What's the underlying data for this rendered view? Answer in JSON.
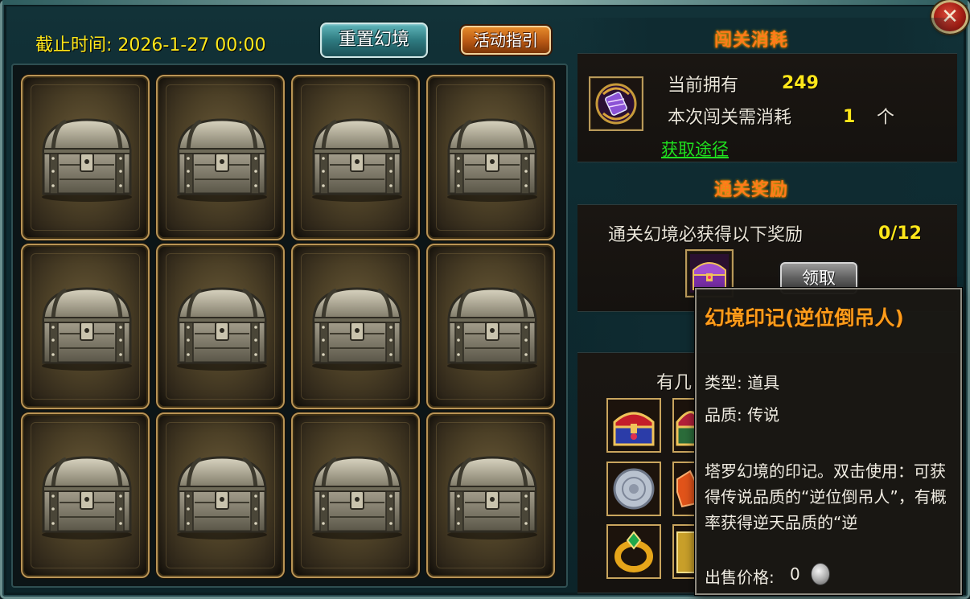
{
  "header": {
    "deadline": "截止时间: 2026-1-27 00:00",
    "reset_button": "重置幻境",
    "guide_button": "活动指引",
    "close_glyph": "✕"
  },
  "grid": {
    "chests": [
      "chest",
      "chest",
      "chest",
      "chest",
      "chest",
      "chest",
      "chest",
      "chest",
      "chest",
      "chest",
      "chest",
      "chest"
    ]
  },
  "cost": {
    "title": "闯关消耗",
    "owned_label": "当前拥有",
    "owned_value": "249",
    "need_label": "本次闯关需消耗",
    "need_value": "1",
    "need_unit": "个",
    "acquire_link": "获取途径"
  },
  "reward": {
    "title": "通关奖励",
    "desc": "通关幻境必获得以下奖励",
    "progress": "0/12",
    "claim_button": "领取"
  },
  "pool": {
    "label_partial": "有几"
  },
  "tooltip": {
    "title": "幻境印记(逆位倒吊人)",
    "type": "类型: 道具",
    "quality": "品质: 传说",
    "description": "塔罗幻境的印记。双击使用：可获得传说品质的“逆位倒吊人”，有概率获得逆天品质的“逆",
    "price_label": "出售价格:",
    "price_value": "0"
  },
  "colors": {
    "accent_yellow": "#ffe71a",
    "title_orange": "#ff7a1a",
    "link_green": "#1fe01f",
    "tooltip_title": "#ff9c1a"
  }
}
